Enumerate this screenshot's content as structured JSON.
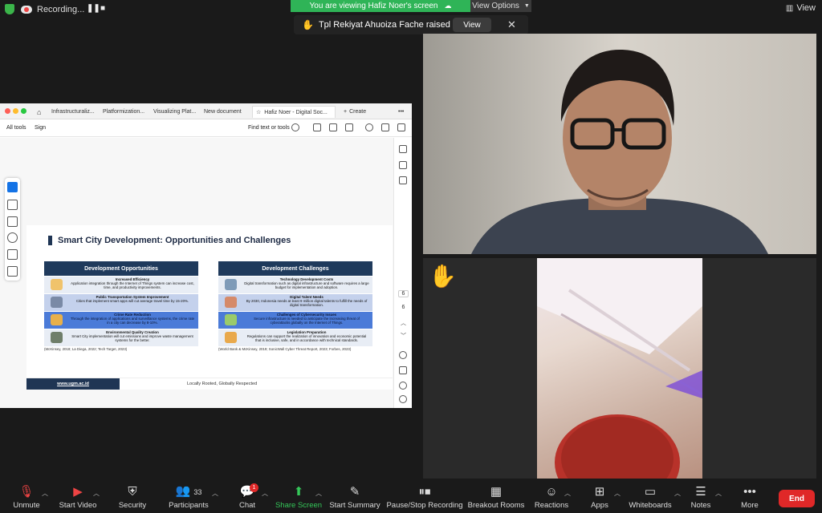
{
  "topbar": {
    "recording_label": "Recording...",
    "viewing_banner": "You are viewing Hafiz Noer's screen",
    "view_options_label": "View Options",
    "view_label": "View"
  },
  "raised_hand": {
    "message": "Tpl Rekiyat Ahuoiza Fache raised hand",
    "view_button": "View"
  },
  "pdf": {
    "tabs": [
      "Infrastructuraliz...",
      "Platformization...",
      "Visualizing Plat...",
      "New document",
      "Hafiz Noer - Digital Soc...",
      "Create"
    ],
    "toolbar": {
      "all_tools": "All tools",
      "sign": "Sign",
      "find": "Find text or tools"
    },
    "page_current": "6",
    "page_total": "6"
  },
  "slide": {
    "title": "Smart City Development: Opportunities and Challenges",
    "opportunities": {
      "header": "Development Opportunities",
      "items": [
        {
          "title": "Increased Efficiency",
          "text": "Application integration through the Internet of Things system can increase cost, time, and productivity improvements."
        },
        {
          "title": "Public Transportation System Improvement",
          "text": "Cities that implement smart apps will cut average travel time by 15-20%."
        },
        {
          "title": "Crime Rate Reduction",
          "text": "Through the integration of applications and surveillance systems, the crime rate in a city can decrease by 8-10%."
        },
        {
          "title": "Environmental Quality Creation",
          "text": "Smart City implementation will cut emissions and improve waste management systems for the better."
        }
      ],
      "citation": "(McKinsey, 2018; La Diega, 2022; Tech Target, 2023)"
    },
    "challenges": {
      "header": "Development Challenges",
      "items": [
        {
          "title": "Technology Development Costs",
          "text": "Digital transformation such as digital infrastructure and software requires a large budget for implementation and adoption."
        },
        {
          "title": "Digital Talent Needs",
          "text": "By 2030, Indonesia needs at least 9 million digital talents to fulfill the needs of digital transformation."
        },
        {
          "title": "Challenges of Cybersecurity Issues",
          "text": "Secure infrastructure is needed to anticipate the increasing threat of cyberattacks globally on the Internet of Things."
        },
        {
          "title": "Legislation Preparation",
          "text": "Regulations can support the realization of innovation and economic potential that is inclusive, safe, and in accordance with technical standards."
        }
      ],
      "citation": "(World Bank & McKinsey, 2019; SonicWall Cyber Threat Report, 2023; Forbes, 2023)"
    },
    "footer_url": "www.ugm.ac.id",
    "footer_tagline": "Locally Rooted, Globally Respected"
  },
  "toolbar": {
    "unmute": "Unmute",
    "start_video": "Start Video",
    "security": "Security",
    "participants": "Participants",
    "participants_count": "33",
    "chat": "Chat",
    "chat_badge": "1",
    "share_screen": "Share Screen",
    "start_summary": "Start Summary",
    "pause_stop_recording": "Pause/Stop Recording",
    "breakout_rooms": "Breakout Rooms",
    "reactions": "Reactions",
    "apps": "Apps",
    "whiteboards": "Whiteboards",
    "notes": "Notes",
    "more": "More",
    "end": "End"
  },
  "colors": {
    "banner_green": "#2fb457",
    "end_red": "#e02828",
    "slide_navy": "#1f3a5c",
    "share_green": "#35c759"
  }
}
